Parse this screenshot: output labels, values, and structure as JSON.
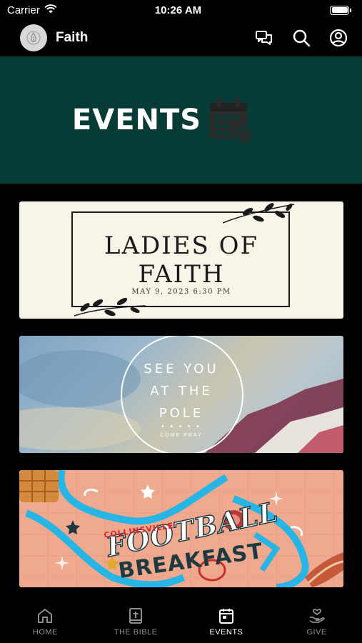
{
  "status_bar": {
    "carrier": "Carrier",
    "time": "10:26 AM",
    "battery_level": 1.0
  },
  "header": {
    "app_title": "Faith",
    "icons": [
      "chat-icon",
      "search-icon",
      "account-icon"
    ]
  },
  "hero": {
    "title": "EVENTS",
    "icon": "calendar-clock-icon",
    "background": "#073b35"
  },
  "events": [
    {
      "title_line1": "LADIES OF",
      "title_line2": "FAITH",
      "date": "MAY 9, 2023 6:30 PM"
    },
    {
      "line1": "SEE YOU",
      "line2": "AT THE",
      "line3": "POLE",
      "dots": "• • • • •",
      "subtitle": "COME PRAY"
    },
    {
      "town": "COLLINSVILLE",
      "word1": "FOOTBALL",
      "word2": "BREAKFAST"
    }
  ],
  "tabs": [
    {
      "label": "HOME",
      "icon": "home-icon",
      "active": false
    },
    {
      "label": "THE BIBLE",
      "icon": "bible-icon",
      "active": false
    },
    {
      "label": "EVENTS",
      "icon": "calendar-icon",
      "active": true
    },
    {
      "label": "GIVE",
      "icon": "give-icon",
      "active": false
    }
  ]
}
